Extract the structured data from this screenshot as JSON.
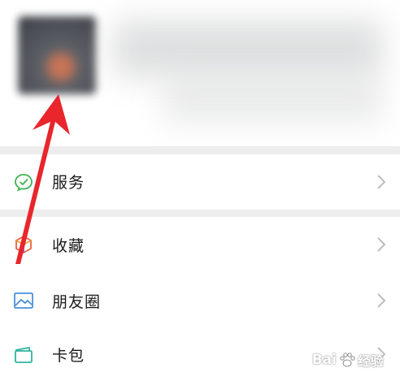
{
  "menu": {
    "services": {
      "label": "服务",
      "icon": "services-icon"
    },
    "favorites": {
      "label": "收藏",
      "icon": "favorites-icon"
    },
    "moments": {
      "label": "朋友圈",
      "icon": "moments-icon"
    },
    "cards": {
      "label": "卡包",
      "icon": "cards-icon"
    }
  },
  "watermark": {
    "brand": "Bai",
    "suffix": "经验"
  },
  "colors": {
    "background": "#ffffff",
    "divider": "#ededed",
    "annotation_arrow": "#e8262c",
    "services_green": "#3fb352"
  }
}
